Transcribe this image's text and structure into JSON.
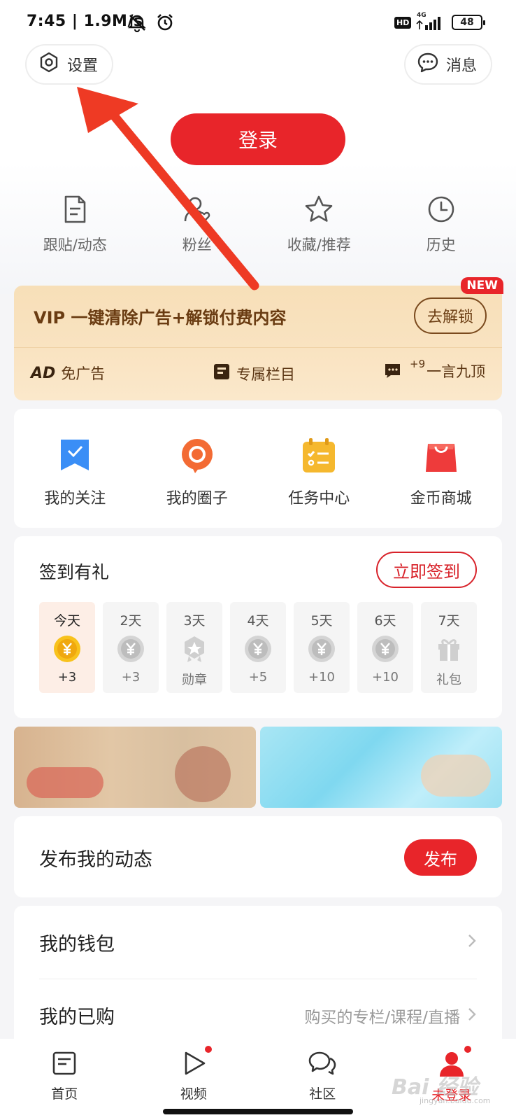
{
  "status_bar": {
    "time": "7:45 | 1.9M/s",
    "network": "4G",
    "hd": "HD",
    "battery": "48"
  },
  "header": {
    "settings_label": "设置",
    "messages_label": "消息",
    "login_label": "登录"
  },
  "quick_links": [
    {
      "label": "跟贴/动态",
      "icon": "document-icon"
    },
    {
      "label": "粉丝",
      "icon": "fans-icon"
    },
    {
      "label": "收藏/推荐",
      "icon": "star-icon"
    },
    {
      "label": "历史",
      "icon": "clock-icon"
    }
  ],
  "vip": {
    "badge": "NEW",
    "title": "VIP 一键清除广告+解锁付费内容",
    "unlock_label": "去解锁",
    "perks": [
      {
        "label": "免广告",
        "icon": "ad-icon",
        "logo": "AD"
      },
      {
        "label": "专属栏目",
        "icon": "column-icon"
      },
      {
        "label": "一言九顶",
        "icon": "comment-icon",
        "badge": "+9"
      }
    ]
  },
  "features": [
    {
      "label": "我的关注",
      "icon": "bookmark-icon",
      "color": "#3a8ef6"
    },
    {
      "label": "我的圈子",
      "icon": "circle-icon",
      "color": "#f36b34"
    },
    {
      "label": "任务中心",
      "icon": "task-icon",
      "color": "#f5b82e"
    },
    {
      "label": "金币商城",
      "icon": "shopping-bag-icon",
      "color": "#ee3b3b"
    }
  ],
  "checkin": {
    "title": "签到有礼",
    "button_label": "立即签到",
    "days": [
      {
        "name": "今天",
        "reward": "+3",
        "icon": "coin-icon",
        "today": true
      },
      {
        "name": "2天",
        "reward": "+3",
        "icon": "coin-icon"
      },
      {
        "name": "3天",
        "reward": "勋章",
        "icon": "medal-icon"
      },
      {
        "name": "4天",
        "reward": "+5",
        "icon": "coin-icon"
      },
      {
        "name": "5天",
        "reward": "+10",
        "icon": "coin-icon"
      },
      {
        "name": "6天",
        "reward": "+10",
        "icon": "coin-icon"
      },
      {
        "name": "7天",
        "reward": "礼包",
        "icon": "gift-icon"
      }
    ]
  },
  "post": {
    "title": "发布我的动态",
    "button_label": "发布"
  },
  "list": {
    "wallet_label": "我的钱包",
    "purchased_label": "我的已购",
    "purchased_sub": "购买的专栏/课程/直播"
  },
  "bottom_nav": [
    {
      "label": "首页",
      "icon": "home-icon"
    },
    {
      "label": "视频",
      "icon": "video-icon",
      "dot": true
    },
    {
      "label": "社区",
      "icon": "community-icon"
    },
    {
      "label": "未登录",
      "icon": "user-icon",
      "dot": true,
      "active": true
    }
  ],
  "watermark": {
    "logo": "Bai 经验",
    "url": "jingyan.baidu.com"
  },
  "colors": {
    "accent": "#e8252a",
    "vip_text": "#6a3c12",
    "annotation_arrow": "#ee3a24"
  }
}
